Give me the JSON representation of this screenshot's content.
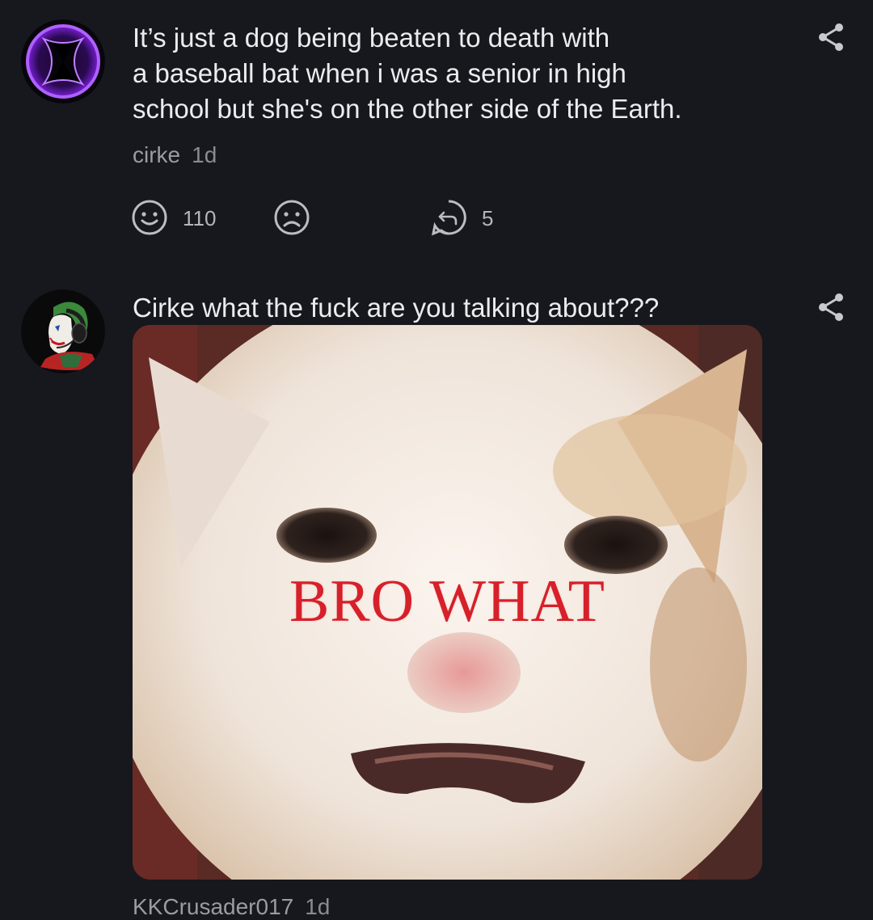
{
  "comments": [
    {
      "text": "It’s just a dog being beaten to death with a baseball bat when i was a senior in high school but she's on the other side of the Earth.",
      "text_lines": [
        "It’s just a dog being beaten to death with",
        "a baseball bat when i was a senior in high",
        "school but she's on the other side of the Earth."
      ],
      "author": "cirke",
      "time": "1d",
      "upvotes": "110",
      "replies": "5",
      "avatar_icon": "purple-portal-icon",
      "share_icon": "share-icon"
    },
    {
      "text": "Cirke what the fuck are you talking about???",
      "author": "KKCrusader017",
      "time": "1d",
      "avatar_icon": "joker-headset-avatar",
      "share_icon": "share-icon",
      "image_caption": "BRO WHAT",
      "image_subject": "cat-meme-image"
    }
  ],
  "colors": {
    "background": "#17181d",
    "text": "#ececf0",
    "muted": "#9a9ba3",
    "accent_purple": "#a040ff",
    "caption_red": "#d6202a"
  }
}
